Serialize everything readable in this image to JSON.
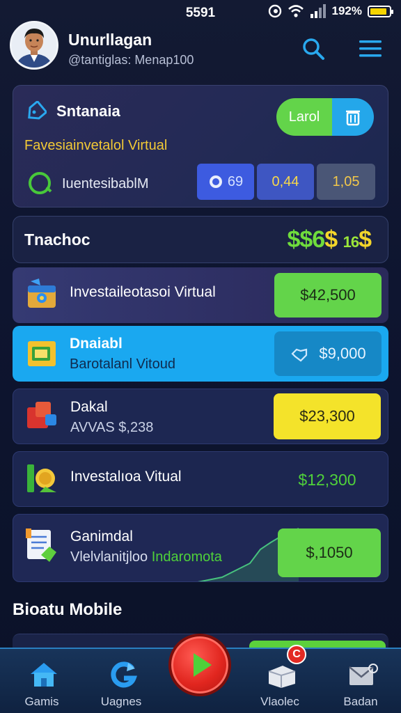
{
  "status_bar": {
    "time": "5591",
    "battery": "192%",
    "battery_level": 0.9
  },
  "header": {
    "user_name": "Unurllagan",
    "user_sub": "@tantiglas: Menap100"
  },
  "top_card": {
    "title": "Sntanaia",
    "subtitle": "Favesiainvetalol Virtual",
    "label": "IuentesibablМ",
    "pill_label": "Larol",
    "stats": [
      "69",
      "0,44",
      "1,05"
    ]
  },
  "transactions": {
    "label": "Tnachoc",
    "amount_green": "$$6",
    "amount_yellow": "$",
    "amount_small": "16",
    "amount_end": "$"
  },
  "rows": [
    {
      "title": "Investaileotasoi Virtual",
      "sub": "",
      "value": "$42,500"
    },
    {
      "title": "Dnaiabl",
      "sub": "Barotalanl Vitoud",
      "value": "$9,000"
    },
    {
      "title": "Dakal",
      "sub": "AVVAS $,238",
      "value": "$23,300"
    },
    {
      "title": "Investalıoa Vitual",
      "sub": "",
      "value": "$12,300"
    },
    {
      "title": "Ganimdal",
      "sub_white": "Vlelvlanitjloo",
      "sub_green": "Indaromota",
      "value": "$,1050"
    }
  ],
  "section_title": "Bioatu Mobile",
  "nav": {
    "games": "Gamis",
    "leagues": "Uagnes",
    "video": "Vlaolec",
    "badan": "Badan",
    "badge": "C"
  },
  "colors": {
    "accent_green": "#63d44a",
    "accent_blue": "#1aa8f0",
    "accent_yellow": "#f3d52b",
    "play_red": "#e1261f"
  }
}
